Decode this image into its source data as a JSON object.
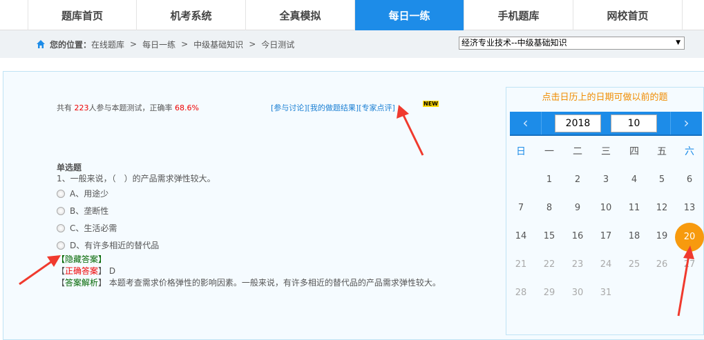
{
  "nav": {
    "tabs": [
      {
        "label": "题库首页"
      },
      {
        "label": "机考系统"
      },
      {
        "label": "全真模拟"
      },
      {
        "label": "每日一练",
        "active": true
      },
      {
        "label": "手机题库"
      },
      {
        "label": "网校首页"
      }
    ]
  },
  "breadcrumb": {
    "prefix": "您的位置：",
    "items": [
      "在线题库",
      "每日一练",
      "中级基础知识",
      "今日测试"
    ],
    "sep": ">"
  },
  "subject_select": {
    "value": "经济专业技术--中级基础知识"
  },
  "stats": {
    "pre": "共有 ",
    "count": "223",
    "mid": "人参与本题测试，正确率 ",
    "rate": "68.6%"
  },
  "links": [
    "[参与讨论]",
    "[我的做题结果]",
    "[专家点评]"
  ],
  "new_badge": "NEW",
  "question": {
    "type": "单选题",
    "stem": "1、一般来说，（　）的产品需求弹性较大。",
    "options": [
      "A、用途少",
      "B、垄断性",
      "C、生活必需",
      "D、有许多相近的替代品"
    ],
    "hide_answer": "【隐藏答案】",
    "correct_label": "正确答案",
    "correct_value": "D",
    "analysis_label": "答案解析",
    "analysis": "本题考查需求价格弹性的影响因素。一般来说，有许多相近的替代品的产品需求弹性较大。"
  },
  "calendar": {
    "hint": "点击日历上的日期可做以前的题",
    "year": "2018",
    "month": "10",
    "prev": "‹",
    "next": "›",
    "weekdays": [
      "日",
      "一",
      "二",
      "三",
      "四",
      "五",
      "六"
    ],
    "first_weekday": 1,
    "days_in_month": 31,
    "today": 20
  },
  "colors": {
    "accent": "#1d8ce8",
    "today": "#f79a0e",
    "hint": "#f08c00"
  }
}
